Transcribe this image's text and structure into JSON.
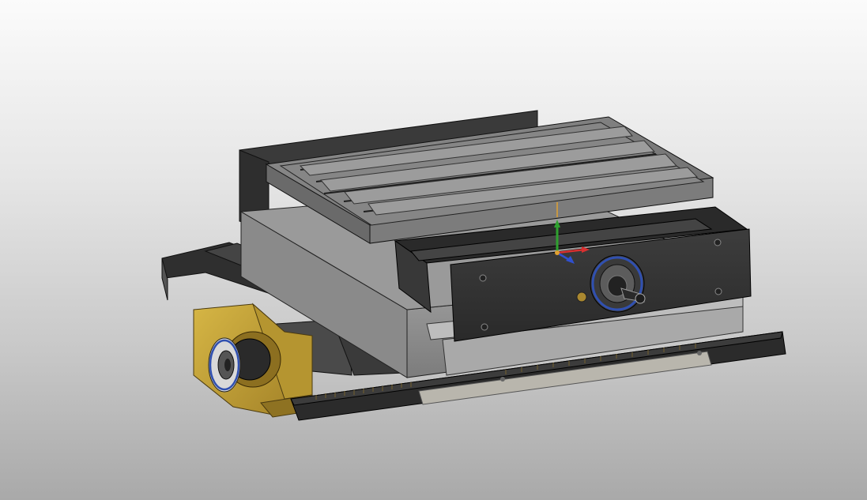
{
  "viewport": {
    "background_top": "#fbfbfb",
    "background_bottom": "#a9a9a9"
  },
  "model": {
    "colors": {
      "body_dark": "#3a3a3a",
      "body_mid": "#6f6f6f",
      "body_light": "#8a8a8a",
      "table_top": "#7b7b7b",
      "yellow_bracket": "#c9a83a",
      "rack": "#2b2b2b",
      "rail_light": "#b9b6ad"
    }
  },
  "triad": {
    "x_color": "#d83030",
    "y_color": "#2fa02f",
    "z_color": "#3050d0",
    "origin_color": "#e0a030"
  },
  "handwheels": [
    {
      "name": "front-handwheel",
      "ring_color": "#3050b0"
    },
    {
      "name": "side-handwheel",
      "ring_color": "#3050b0"
    }
  ]
}
